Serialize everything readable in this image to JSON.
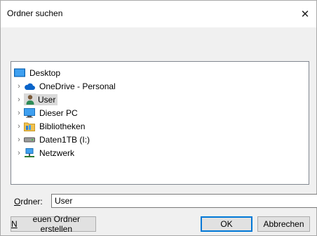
{
  "window": {
    "title": "Ordner suchen",
    "close_glyph": "✕"
  },
  "tree": {
    "items": [
      {
        "label": "Desktop",
        "icon": "desktop-icon",
        "expandable": false
      },
      {
        "label": "OneDrive - Personal",
        "icon": "cloud-icon",
        "expandable": true
      },
      {
        "label": "User",
        "icon": "user-icon",
        "expandable": true,
        "selected": true
      },
      {
        "label": "Dieser PC",
        "icon": "computer-icon",
        "expandable": true
      },
      {
        "label": "Bibliotheken",
        "icon": "libraries-icon",
        "expandable": true
      },
      {
        "label": "Daten1TB (I:)",
        "icon": "drive-icon",
        "expandable": true
      },
      {
        "label": "Netzwerk",
        "icon": "network-icon",
        "expandable": true
      }
    ],
    "chevron_glyph": "›"
  },
  "folder": {
    "label_first": "O",
    "label_rest": "rdner:",
    "value": "User"
  },
  "buttons": {
    "new_folder_first": "N",
    "new_folder_rest": "euen Ordner erstellen",
    "ok": "OK",
    "cancel": "Abbrechen"
  },
  "colors": {
    "default_button_border": "#0078d7",
    "tree_border": "#828790"
  }
}
